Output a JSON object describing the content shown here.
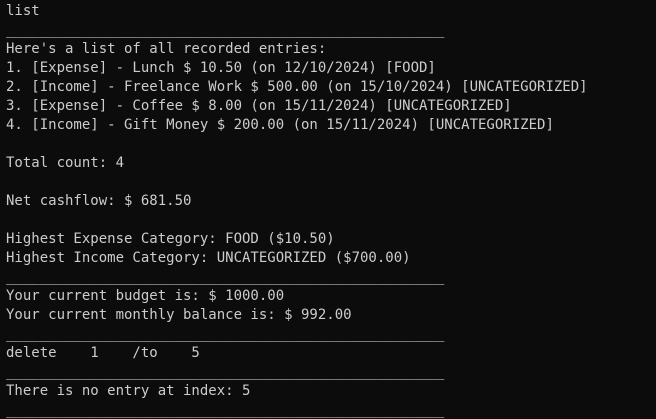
{
  "terminal": {
    "lines": [
      "list",
      "____________________________________________________",
      "Here's a list of all recorded entries:",
      "1. [Expense] - Lunch $ 10.50 (on 12/10/2024) [FOOD]",
      "2. [Income] - Freelance Work $ 500.00 (on 15/10/2024) [UNCATEGORIZED]",
      "3. [Expense] - Coffee $ 8.00 (on 15/11/2024) [UNCATEGORIZED]",
      "4. [Income] - Gift Money $ 200.00 (on 15/11/2024) [UNCATEGORIZED]",
      "",
      "Total count: 4",
      "",
      "Net cashflow: $ 681.50",
      "",
      "Highest Expense Category: FOOD ($10.50)",
      "Highest Income Category: UNCATEGORIZED ($700.00)",
      "____________________________________________________",
      "Your current budget is: $ 1000.00",
      "Your current monthly balance is: $ 992.00",
      "____________________________________________________",
      "delete    1    /to    5",
      "____________________________________________________",
      "There is no entry at index: 5",
      "____________________________________________________"
    ]
  }
}
